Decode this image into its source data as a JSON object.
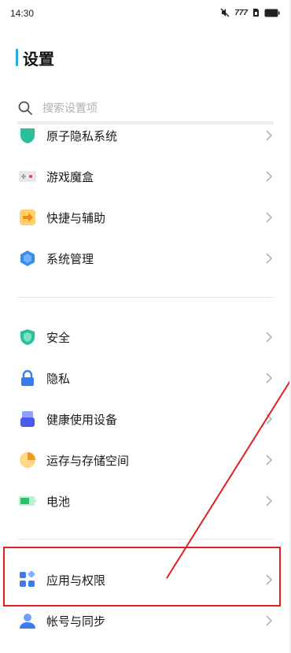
{
  "status_bar": {
    "time": "14:30",
    "icons": [
      "mute-icon",
      "signal-icon",
      "sim-icon",
      "battery-icon"
    ],
    "signal_text": "777"
  },
  "page": {
    "title": "设置",
    "accent_color": "#2ea7e0"
  },
  "search": {
    "placeholder": "搜索设置项"
  },
  "sections": [
    {
      "items": [
        {
          "label": "原子隐私系统",
          "icon": "privacy-system-icon",
          "color": "#2bbf9a"
        },
        {
          "label": "游戏魔盒",
          "icon": "game-box-icon",
          "color": "#e04040"
        },
        {
          "label": "快捷与辅助",
          "icon": "shortcut-icon",
          "color": "#f5a623"
        },
        {
          "label": "系统管理",
          "icon": "system-manage-icon",
          "color": "#3a8cf0"
        }
      ]
    },
    {
      "items": [
        {
          "label": "安全",
          "icon": "security-shield-icon",
          "color": "#2bbf9a"
        },
        {
          "label": "隐私",
          "icon": "privacy-lock-icon",
          "color": "#3a7cf0"
        },
        {
          "label": "健康使用设备",
          "icon": "health-use-icon",
          "color": "#5b6cf0"
        },
        {
          "label": "运存与存储空间",
          "icon": "storage-pie-icon",
          "color": "#f5a623"
        },
        {
          "label": "电池",
          "icon": "battery-setting-icon",
          "color": "#2bbf6a"
        }
      ]
    },
    {
      "items": [
        {
          "label": "应用与权限",
          "icon": "apps-permission-icon",
          "color": "#3a7cf0"
        },
        {
          "label": "帐号与同步",
          "icon": "account-sync-icon",
          "color": "#3a7cf0"
        }
      ]
    }
  ],
  "annotation_color": "#e02020"
}
